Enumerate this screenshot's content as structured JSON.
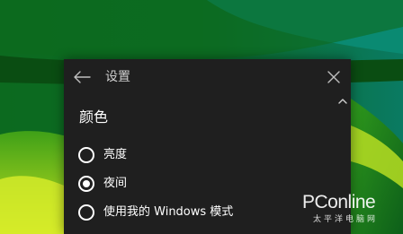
{
  "window": {
    "title": "设置",
    "back_icon": "back-arrow-icon",
    "close_icon": "close-icon"
  },
  "section": {
    "heading": "颜色",
    "options": [
      {
        "label": "亮度",
        "checked": false
      },
      {
        "label": "夜间",
        "checked": true
      },
      {
        "label": "使用我的 Windows 模式",
        "checked": false
      }
    ]
  },
  "watermark": {
    "main": "PConline",
    "sub": "太平洋电脑网"
  },
  "colors": {
    "panel_bg": "#1f1f1f",
    "text": "#ffffff",
    "wallpaper_dark": "#0a5a1a",
    "wallpaper_accent": "#9ad11a",
    "wallpaper_teal": "#0a7f6a"
  }
}
